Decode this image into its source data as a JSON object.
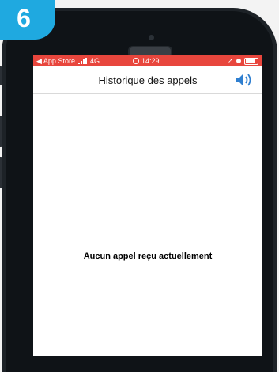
{
  "badge": {
    "step": "6"
  },
  "statusbar": {
    "back_label": "◀ App Store",
    "network": "4G",
    "time": "14:29",
    "location_icon": "location-arrow-icon",
    "background_color": "#e8463d"
  },
  "navbar": {
    "title": "Historique des appels",
    "sound_icon": "speaker-volume-icon",
    "accent_color": "#2f7fd0"
  },
  "content": {
    "empty_message": "Aucun appel reçu actuellement"
  },
  "colors": {
    "badge": "#1fa9e0",
    "phone_frame": "#1d2227"
  }
}
